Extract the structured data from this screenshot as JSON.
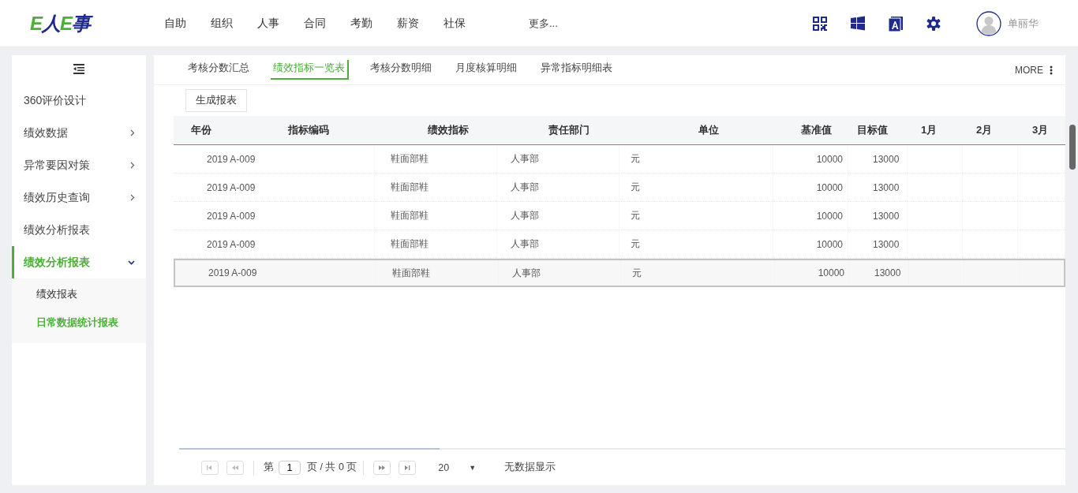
{
  "header": {
    "logo": "E人E事",
    "nav": [
      {
        "label": "自助"
      },
      {
        "label": "组织"
      },
      {
        "label": "人事"
      },
      {
        "label": "合同"
      },
      {
        "label": "考勤"
      },
      {
        "label": "薪资"
      },
      {
        "label": "社保"
      },
      {
        "label": "更多..."
      }
    ],
    "tools": [
      {
        "kind": "qr"
      },
      {
        "kind": "windows"
      },
      {
        "kind": "font"
      },
      {
        "kind": "settings"
      }
    ],
    "user": "单丽华"
  },
  "sidebar": {
    "items": [
      {
        "label": "360评价设计",
        "kind": "link",
        "selected": false
      },
      {
        "label": "绩效数据",
        "kind": "group",
        "expanded": false,
        "selected": false
      },
      {
        "label": "异常要因对策",
        "kind": "group",
        "expanded": false,
        "selected": false
      },
      {
        "label": "绩效历史查询",
        "kind": "group",
        "expanded": false,
        "selected": false
      },
      {
        "label": "绩效分析报表",
        "kind": "link",
        "selected": false
      },
      {
        "label": "绩效分析报表",
        "kind": "group",
        "expanded": true,
        "selected": true,
        "children": [
          {
            "label": "绩效报表",
            "selected": false
          },
          {
            "label": "日常数据统计报表",
            "selected": true
          }
        ]
      }
    ]
  },
  "tabs": [
    {
      "label": "考核分数汇总",
      "selected": false
    },
    {
      "label": "绩效指标一览表",
      "selected": true
    },
    {
      "label": "考核分数明细",
      "selected": false
    },
    {
      "label": "月度核算明细",
      "selected": false
    },
    {
      "label": "异常指标明细表",
      "selected": false
    }
  ],
  "more": "MORE",
  "generate_button": "生成报表",
  "table": {
    "columns": [
      "年份",
      "指标编码",
      "绩效指标",
      "责任部门",
      "单位",
      "基准值",
      "目标值",
      "1月",
      "2月",
      "3月"
    ],
    "rows": [
      {
        "year_code": "2019 A-009",
        "indicator": "鞋面部鞋",
        "department": "人事部",
        "unit": "元",
        "baseline": "10000",
        "target": "13000",
        "selected": false
      },
      {
        "year_code": "2019 A-009",
        "indicator": "鞋面部鞋",
        "department": "人事部",
        "unit": "元",
        "baseline": "10000",
        "target": "13000",
        "selected": false
      },
      {
        "year_code": "2019 A-009",
        "indicator": "鞋面部鞋",
        "department": "人事部",
        "unit": "元",
        "baseline": "10000",
        "target": "13000",
        "selected": false
      },
      {
        "year_code": "2019 A-009",
        "indicator": "鞋面部鞋",
        "department": "人事部",
        "unit": "元",
        "baseline": "10000",
        "target": "13000",
        "selected": false
      },
      {
        "year_code": "2019 A-009",
        "indicator": "鞋面部鞋",
        "department": "人事部",
        "unit": "元",
        "baseline": "10000",
        "target": "13000",
        "selected": true
      }
    ]
  },
  "pager": {
    "page_prefix": "第",
    "page": "1",
    "page_suffix": "页 / 共 0 页",
    "page_size": "20",
    "size_caret": "▼",
    "status": "无数据显示"
  }
}
